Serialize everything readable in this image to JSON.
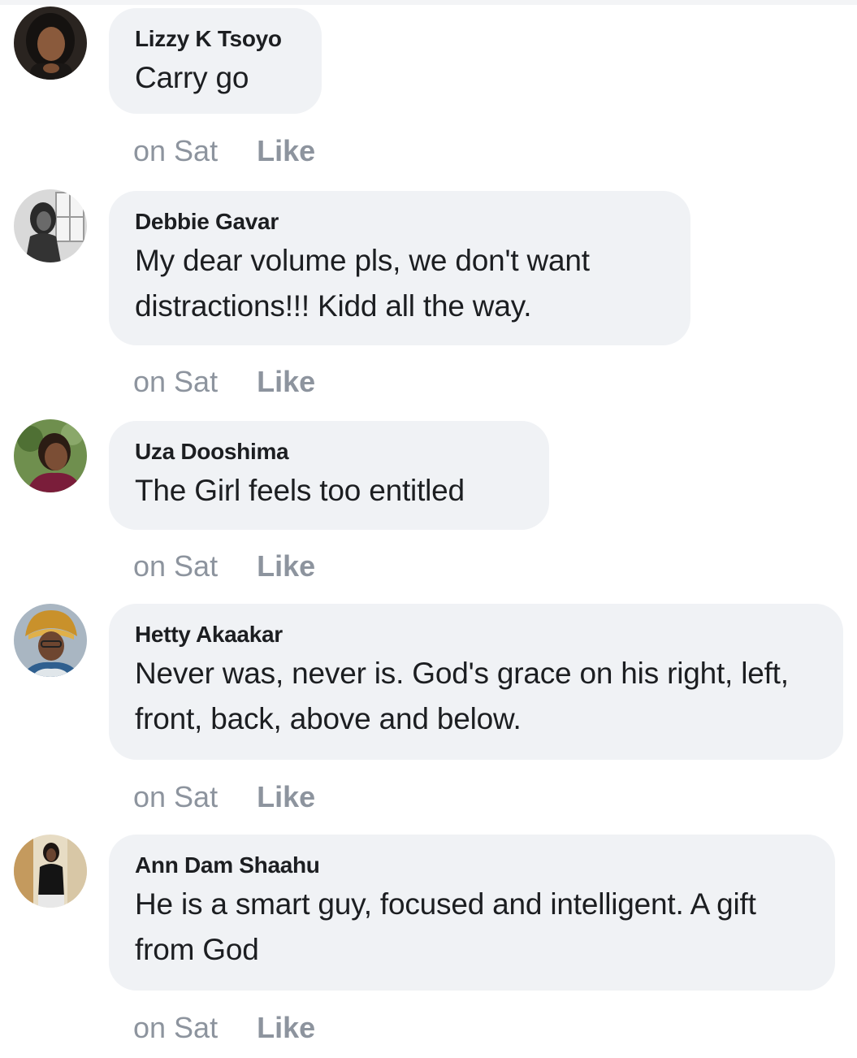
{
  "comments": [
    {
      "author": "Lizzy K Tsoyo",
      "text": "Carry go",
      "time": "on Sat",
      "action": "Like"
    },
    {
      "author": "Debbie Gavar",
      "text": "My dear volume pls, we don't want distractions!!! Kidd all the way.",
      "time": "on Sat",
      "action": "Like"
    },
    {
      "author": "Uza Dooshima",
      "text": "The Girl feels too entitled",
      "time": "on Sat",
      "action": "Like"
    },
    {
      "author": "Hetty Akaakar",
      "text": "Never was, never is. God's grace on his right, left, front, back, above and below.",
      "time": "on Sat",
      "action": "Like"
    },
    {
      "author": "Ann Dam Shaahu",
      "text": "He is a smart guy, focused and intelligent. A gift from God",
      "time": "on Sat",
      "action": "Like"
    }
  ]
}
